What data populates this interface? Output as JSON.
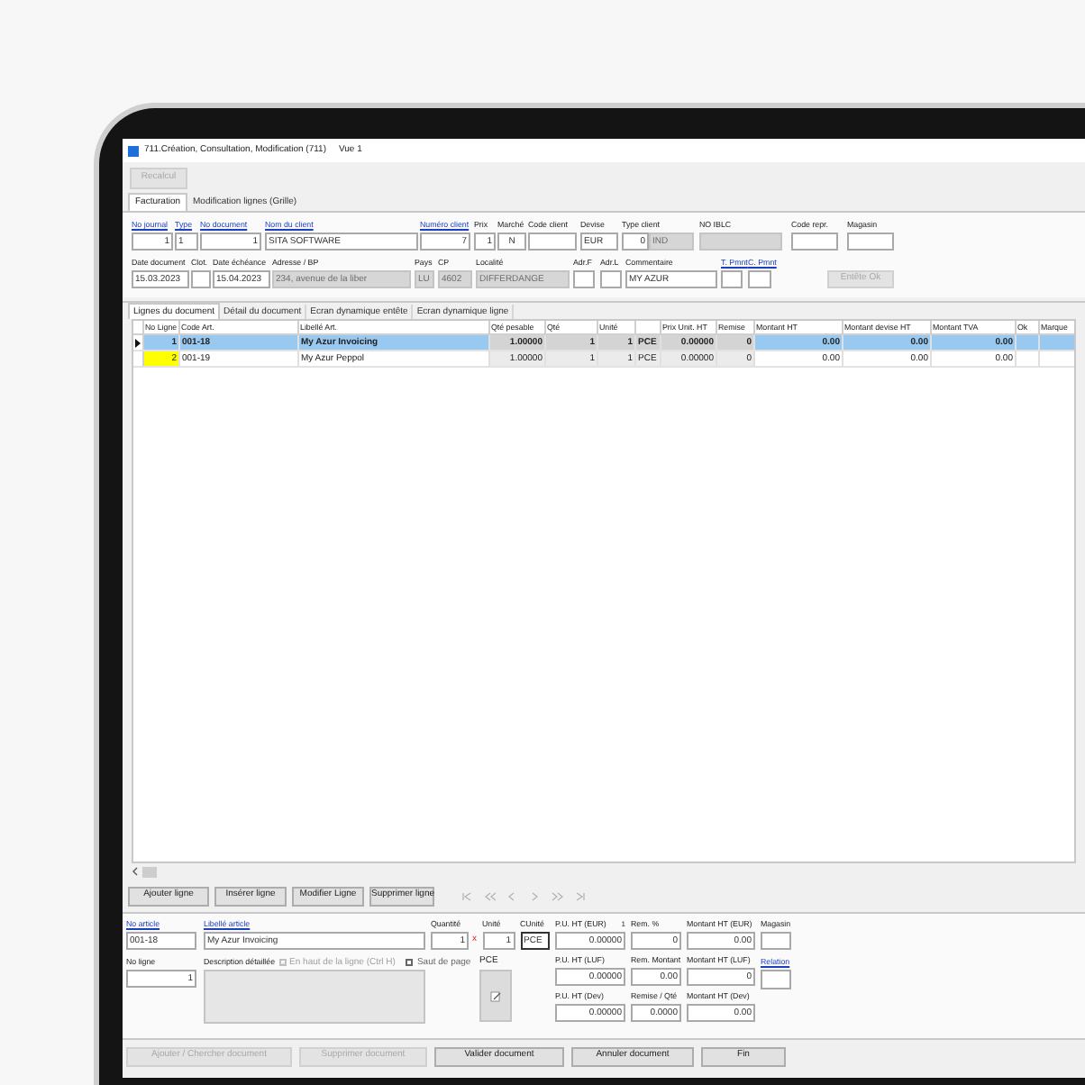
{
  "window": {
    "title": "711.Création, Consultation, Modification (711)",
    "view": "Vue 1"
  },
  "toolbar": {
    "buttons": [
      {
        "label": "Recalcul",
        "disabled": true
      }
    ]
  },
  "tabs": [
    {
      "label": "Facturation",
      "selected": true
    },
    {
      "label": "Modification lignes (Grille)",
      "selected": false
    }
  ],
  "header_row_1": [
    {
      "label": "No journal",
      "link": true,
      "value": "1",
      "readonly": false
    },
    {
      "label": "Type",
      "link": true,
      "value": "1",
      "readonly": false
    },
    {
      "label": "No document",
      "link": true,
      "value": "1",
      "readonly": false
    },
    {
      "label": "Nom du client",
      "link": true,
      "value": "SITA SOFTWARE",
      "readonly": false
    },
    {
      "label": "Numéro client",
      "link": true,
      "value": "7",
      "readonly": false
    },
    {
      "label": "Prix",
      "link": false,
      "value": "1",
      "readonly": false
    },
    {
      "label": "Marché",
      "link": false,
      "value": "N",
      "readonly": false
    },
    {
      "label": "Code client",
      "link": false,
      "readonly": false
    },
    {
      "label": "Devise",
      "link": false,
      "value": "EUR",
      "readonly": false
    },
    {
      "label": "Type client",
      "link": false,
      "value": "0",
      "readonly": false
    },
    {
      "value": "IND",
      "readonly": true
    },
    {
      "label": "NO IBLC",
      "link": false,
      "readonly": true
    },
    {
      "label": "Code repr.",
      "link": false,
      "readonly": false
    },
    {
      "label": "Magasin",
      "link": false,
      "readonly": false
    }
  ],
  "header_row_2": [
    {
      "label": "Date document",
      "link": false,
      "value": "15.03.2023",
      "readonly": false
    },
    {
      "label": "Clot.",
      "link": false,
      "readonly": false
    },
    {
      "label": "Date échéance",
      "link": false,
      "value": "15.04.2023",
      "readonly": false
    },
    {
      "label": "Adresse / BP",
      "link": false,
      "value": "234, avenue de la liber",
      "readonly": true
    },
    {
      "label": "Pays",
      "link": false,
      "value": "LU",
      "readonly": true
    },
    {
      "label": "CP",
      "link": false,
      "value": "4602",
      "readonly": true
    },
    {
      "label": "Localité",
      "link": false,
      "value": "DIFFERDANGE",
      "readonly": true
    },
    {
      "label": "Adr.F",
      "link": false,
      "readonly": false
    },
    {
      "label": "Adr.L",
      "link": false,
      "readonly": false
    },
    {
      "label": "Commentaire",
      "link": false,
      "value": "MY AZUR",
      "readonly": false
    },
    {
      "label": "T. Pmnt",
      "link": true,
      "readonly": false
    },
    {
      "label": "C. Pmnt",
      "link": true,
      "readonly": false
    }
  ],
  "header_button": {
    "label": "Entête Ok",
    "disabled": true
  },
  "inner_tabs": [
    {
      "label": "Lignes du document",
      "selected": true
    },
    {
      "label": "Détail du document",
      "selected": false
    },
    {
      "label": "Ecran dynamique entête",
      "selected": false
    },
    {
      "label": "Ecran dynamique ligne",
      "selected": false
    }
  ],
  "table": {
    "columns": [
      {
        "label": "No Ligne",
        "shaded": false
      },
      {
        "label": "Code Art.",
        "shaded": false
      },
      {
        "label": "Libellé Art.",
        "shaded": false
      },
      {
        "label": "Qté pesable",
        "shaded": true
      },
      {
        "label": "Qté",
        "shaded": true
      },
      {
        "label": "Unité",
        "shaded": true
      },
      {
        "shaded": true
      },
      {
        "label": "Prix Unit. HT",
        "shaded": true
      },
      {
        "label": "Remise",
        "shaded": true
      },
      {
        "label": "Montant HT",
        "shaded": false
      },
      {
        "label": "Montant devise HT",
        "shaded": false
      },
      {
        "label": "Montant TVA",
        "shaded": false
      },
      {
        "label": "Ok",
        "shaded": false
      },
      {
        "label": "Marque",
        "shaded": false
      }
    ],
    "rows": [
      {
        "selected": true,
        "marked": false,
        "cells": [
          "1",
          "001-18",
          "My Azur Invoicing",
          "1.00000",
          "1",
          "1",
          "PCE",
          "0.00000",
          "0",
          "0.00",
          "0.00",
          "0.00"
        ]
      },
      {
        "selected": false,
        "marked": true,
        "cells": [
          "2",
          "001-19",
          "My Azur Peppol",
          "1.00000",
          "1",
          "1",
          "PCE",
          "0.00000",
          "0",
          "0.00",
          "0.00",
          "0.00"
        ]
      }
    ]
  },
  "line_buttons": [
    {
      "label": "Ajouter ligne"
    },
    {
      "label": "Insérer ligne"
    },
    {
      "label": "Modifier Ligne"
    },
    {
      "label": "Supprimer ligne"
    }
  ],
  "line_form": {
    "no_article": {
      "label": "No article",
      "link": true,
      "value": "001-18"
    },
    "libelle": {
      "label": "Libellé article",
      "link": true,
      "value": "My Azur Invoicing"
    },
    "quantite": {
      "label": "Quantité",
      "value": "1",
      "flag": "x"
    },
    "unite": {
      "label": "Unité",
      "value": "1"
    },
    "cunite": {
      "label": "CUnité",
      "value": "PCE"
    },
    "no_ligne": {
      "label": "No ligne",
      "value": "1"
    },
    "description": {
      "label": "Description détaillée"
    },
    "options": [
      {
        "label": "En haut de la ligne (Ctrl H)",
        "checked": true,
        "disabled": true
      },
      {
        "label": "Saut de page",
        "checked": false,
        "disabled": false
      }
    ],
    "unit_text": "PCE",
    "amounts": [
      [
        {
          "label": "P.U. HT (EUR)",
          "note": "1",
          "value": "0.00000"
        },
        {
          "label": "Rem. %",
          "value": "0"
        },
        {
          "label": "Montant HT (EUR)",
          "value": "0.00"
        }
      ],
      [
        {
          "label": "P.U. HT (LUF)",
          "value": "0.00000"
        },
        {
          "label": "Rem. Montant",
          "value": "0.00"
        },
        {
          "label": "Montant HT (LUF)",
          "value": "0"
        }
      ],
      [
        {
          "label": "P.U. HT (Dev)",
          "value": "0.00000"
        },
        {
          "label": "Remise / Qté",
          "value": "0.0000"
        },
        {
          "label": "Montant HT (Dev)",
          "value": "0.00"
        }
      ]
    ],
    "magasin": {
      "label": "Magasin",
      "link": false
    },
    "relation": {
      "label": "Relation",
      "link": true
    }
  },
  "document_buttons": [
    {
      "label": "Ajouter / Chercher document",
      "disabled": true
    },
    {
      "label": "Supprimer document",
      "disabled": true
    },
    {
      "label": "Valider document",
      "disabled": false
    },
    {
      "label": "Annuler document",
      "disabled": false
    },
    {
      "label": "Fin",
      "disabled": false
    }
  ]
}
